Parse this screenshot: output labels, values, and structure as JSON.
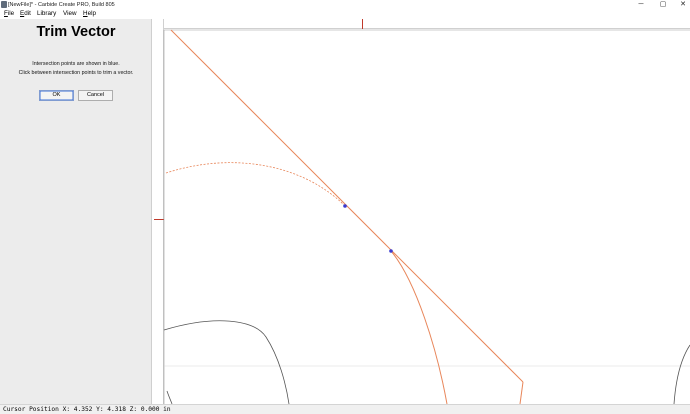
{
  "window": {
    "title": "[NewFile]* - Carbide Create PRO, Build 805",
    "minimize_glyph": "─",
    "maximize_glyph": "▢",
    "close_glyph": "✕"
  },
  "menu": {
    "items": [
      {
        "label": "File",
        "mnemonic": "F",
        "rest": "ile"
      },
      {
        "label": "Edit",
        "mnemonic": "E",
        "rest": "dit"
      },
      {
        "label": "Library",
        "mnemonic": "",
        "rest": "Library"
      },
      {
        "label": "View",
        "mnemonic": "",
        "rest": "View"
      },
      {
        "label": "Help",
        "mnemonic": "H",
        "rest": "elp"
      }
    ]
  },
  "panel": {
    "title": "Trim Vector",
    "instruction_line1": "Intersection points are shown in blue.",
    "instruction_line2": "Click between intersection points to trim a vector.",
    "ok_label": "OK",
    "cancel_label": "Cancel"
  },
  "status": {
    "cursor_position": "Cursor Position X: 4.352 Y: 4.318 Z: 0.000 in"
  },
  "colors": {
    "vector": "#e8865a",
    "intersection_point": "#3a3ad0",
    "other_vector": "#555555",
    "ruler_marker": "#c0392b"
  },
  "icons": {
    "app": "carbide-create-icon"
  }
}
